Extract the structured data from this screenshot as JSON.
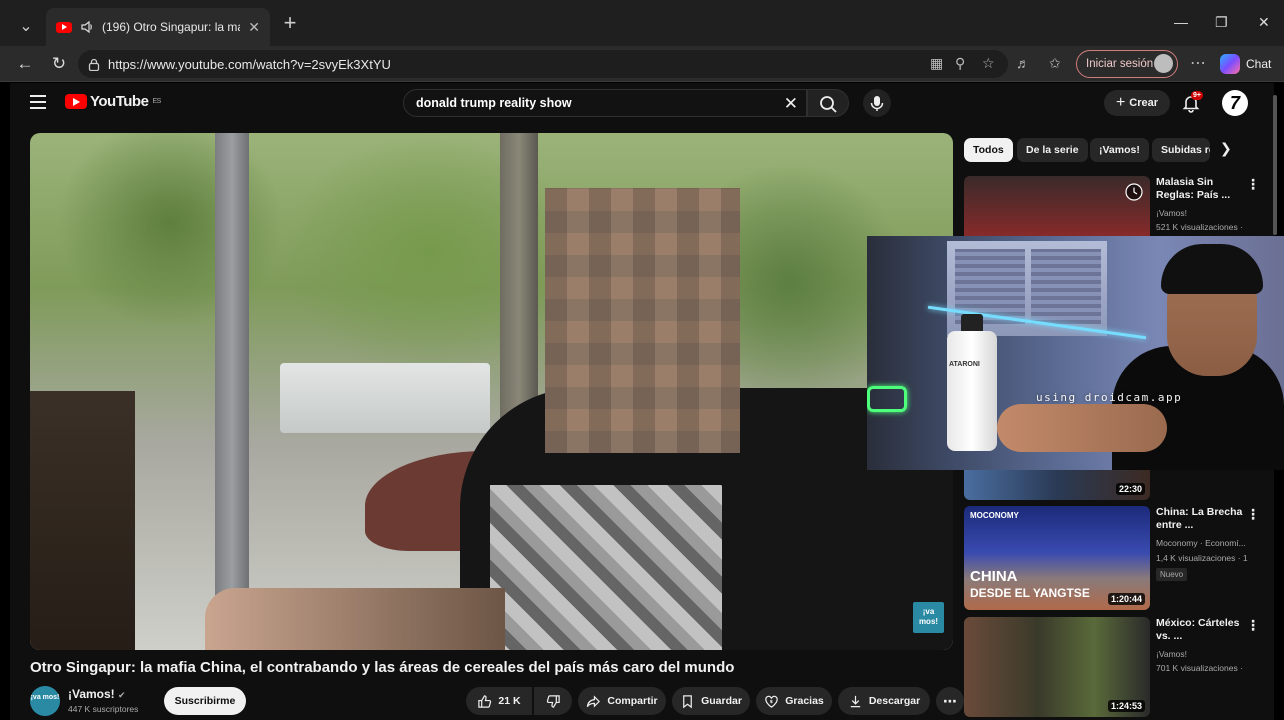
{
  "browser": {
    "tab_title": "(196) Otro Singapur: la mafia C",
    "url": "https://www.youtube.com/watch?v=2svyEk3XtYU",
    "signin_label": "Iniciar sesión",
    "chat_label": "Chat"
  },
  "youtube": {
    "logo_text": "YouTube",
    "logo_region": "ES",
    "search_value": "donald trump reality show",
    "create_label": "Crear",
    "notification_count": "9+"
  },
  "video": {
    "title": "Otro Singapur: la mafia China, el contrabando y las áreas de cereales del país más caro del mundo",
    "watermark": "¡va mos!",
    "channel_name": "¡Vamos!",
    "channel_avatar_text": "¡va mos!",
    "subscribers": "447 K suscriptores",
    "subscribe_label": "Suscribirme",
    "likes": "21 K",
    "share_label": "Compartir",
    "save_label": "Guardar",
    "thanks_label": "Gracias",
    "download_label": "Descargar"
  },
  "chips": [
    {
      "label": "Todos"
    },
    {
      "label": "De la serie"
    },
    {
      "label": "¡Vamos!"
    },
    {
      "label": "Subidas re"
    }
  ],
  "recommendations": [
    {
      "title": "Malasia Sin Reglas: País ...",
      "channel": "¡Vamos!",
      "meta": "521 K visualizaciones ·"
    },
    {
      "duration": "22:30"
    },
    {
      "title": "China: La Brecha entre ...",
      "channel": "Moconomy · Economí...",
      "meta": "1,4 K visualizaciones · 1",
      "badge": "Nuevo",
      "thumb_brand": "MOCONOMY",
      "thumb_line1": "CHINA",
      "thumb_line2": "DESDE EL YANGTSE",
      "duration": "1:20:44"
    },
    {
      "title": "México: Cárteles vs. ...",
      "channel": "¡Vamos!",
      "meta": "701 K visualizaciones ·",
      "duration": "1:24:53"
    }
  ],
  "webcam": {
    "overlay_text": "using droidcam.app",
    "bottle_label": "ATARONI"
  }
}
